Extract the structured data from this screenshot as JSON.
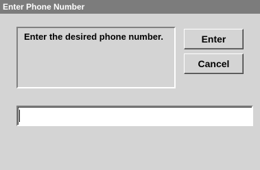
{
  "dialog": {
    "title": "Enter Phone Number",
    "prompt": "Enter the desired phone number.",
    "enter_label": "Enter",
    "cancel_label": "Cancel",
    "phone_value": "",
    "phone_placeholder": ""
  }
}
